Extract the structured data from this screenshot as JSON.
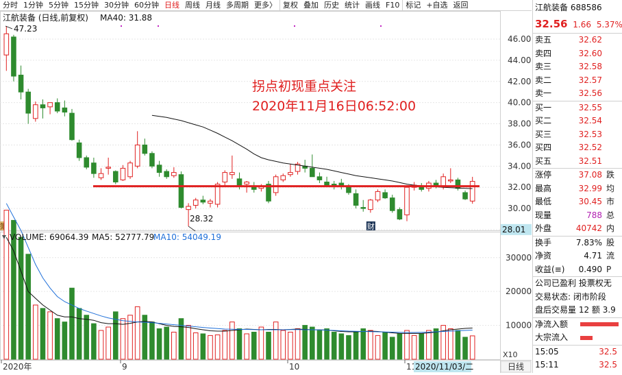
{
  "toolbar": {
    "items": [
      "分时",
      "1分钟",
      "5分钟",
      "15分钟",
      "30分钟",
      "60分钟",
      "日线",
      "周线",
      "月线",
      "多周期",
      "更多〉",
      "复权",
      "叠加",
      "历史",
      "统计",
      "画线",
      "F10",
      "标记",
      "+自选",
      "返回"
    ],
    "active": "日线"
  },
  "kline": {
    "header_name": "江航装备 (日线,前复权)",
    "ma40_label": "MA40: 31.88",
    "y_ticks": [
      "46.00",
      "44.00",
      "42.00",
      "40.00",
      "38.00",
      "36.00",
      "34.00",
      "32.00",
      "30.00",
      "28.00"
    ],
    "high_label": "47.23",
    "low_label": "28.32",
    "price_tag": "28.01",
    "note_text": "拐点初现重点关注",
    "note_time": "2020年11月16日06:52:00",
    "marker_caiwu": "财",
    "marker_left": "簿"
  },
  "volume": {
    "header": "VOLUME: 69064.39",
    "ma5": "MA5: 52777.79",
    "ma10": "MA10: 54049.19",
    "y_ticks": [
      "30000",
      "20000",
      "10000"
    ],
    "unit": "X10"
  },
  "x_axis": {
    "labels": [
      "2020年",
      "9",
      "10",
      "11"
    ],
    "date_box": "2020/11/03/二",
    "period_btn": "日线"
  },
  "colors": {
    "up": "#e02020",
    "down": "#2e8b2e",
    "ma": "#111111",
    "ma10": "#1e6fd9"
  },
  "chart_data": [
    {
      "type": "candlestick",
      "title": "江航装备 (日线,前复权)",
      "ylim": [
        28,
        47.5
      ],
      "ohlc": [
        [
          44.5,
          47.23,
          43.0,
          46.5
        ],
        [
          46.2,
          46.4,
          42.0,
          42.5
        ],
        [
          42.6,
          43.5,
          40.3,
          41.0
        ],
        [
          41.0,
          41.3,
          38.0,
          39.0
        ],
        [
          38.5,
          40.1,
          38.2,
          39.8
        ],
        [
          39.8,
          40.3,
          38.5,
          39.5
        ],
        [
          39.6,
          40.0,
          38.9,
          40.0
        ],
        [
          40.0,
          40.4,
          39.0,
          39.2
        ],
        [
          39.5,
          40.2,
          38.7,
          39.1
        ],
        [
          39.0,
          39.4,
          36.4,
          36.5
        ],
        [
          36.2,
          36.5,
          34.5,
          34.8
        ],
        [
          34.8,
          35.0,
          33.7,
          33.9
        ],
        [
          34.3,
          34.8,
          32.9,
          33.3
        ],
        [
          32.9,
          33.8,
          32.7,
          33.3
        ],
        [
          33.8,
          34.8,
          33.2,
          33.9
        ],
        [
          33.5,
          33.6,
          32.3,
          32.5
        ],
        [
          32.7,
          34.1,
          32.6,
          33.8
        ],
        [
          33.0,
          34.5,
          32.8,
          34.3
        ],
        [
          34.0,
          37.3,
          33.8,
          36.0
        ],
        [
          36.0,
          36.6,
          35.0,
          35.2
        ],
        [
          35.2,
          35.4,
          33.8,
          34.0
        ],
        [
          34.1,
          34.5,
          33.0,
          33.4
        ],
        [
          33.5,
          33.7,
          32.8,
          33.0
        ],
        [
          33.1,
          33.9,
          32.9,
          33.4
        ],
        [
          33.2,
          33.5,
          30.0,
          30.1
        ],
        [
          29.9,
          30.5,
          28.32,
          30.2
        ],
        [
          30.3,
          31.0,
          30.0,
          30.8
        ],
        [
          30.8,
          31.2,
          30.4,
          30.6
        ],
        [
          30.5,
          30.9,
          30.1,
          30.7
        ],
        [
          30.4,
          32.5,
          30.1,
          32.3
        ],
        [
          32.5,
          33.6,
          32.1,
          33.4
        ],
        [
          33.2,
          35.0,
          32.8,
          33.4
        ],
        [
          32.8,
          33.4,
          31.8,
          32.2
        ],
        [
          32.3,
          32.6,
          31.5,
          32.5
        ],
        [
          32.0,
          32.5,
          31.5,
          31.8
        ],
        [
          31.9,
          32.3,
          31.6,
          32.1
        ],
        [
          32.3,
          32.6,
          30.5,
          30.7
        ],
        [
          31.5,
          33.2,
          31.2,
          33.0
        ],
        [
          32.7,
          33.3,
          32.5,
          33.1
        ],
        [
          33.2,
          34.2,
          33.0,
          33.4
        ],
        [
          33.5,
          34.4,
          33.2,
          34.2
        ],
        [
          34.0,
          34.6,
          33.4,
          33.8
        ],
        [
          33.8,
          35.1,
          33.4,
          33.0
        ],
        [
          33.0,
          33.4,
          32.4,
          32.7
        ],
        [
          32.5,
          33.0,
          32.1,
          32.2
        ],
        [
          32.3,
          32.6,
          31.8,
          32.1
        ],
        [
          32.4,
          32.8,
          31.8,
          32.2
        ],
        [
          32.1,
          32.3,
          31.3,
          31.5
        ],
        [
          31.4,
          31.8,
          30.0,
          30.3
        ],
        [
          30.1,
          30.8,
          29.7,
          30.0
        ],
        [
          29.9,
          30.9,
          29.6,
          30.8
        ],
        [
          30.8,
          31.8,
          30.6,
          31.6
        ],
        [
          31.5,
          31.8,
          30.9,
          31.0
        ],
        [
          31.0,
          31.3,
          29.6,
          29.8
        ],
        [
          29.9,
          30.1,
          28.9,
          29.0
        ],
        [
          29.4,
          32.2,
          28.8,
          32.0
        ],
        [
          32.0,
          32.5,
          31.7,
          32.2
        ],
        [
          32.0,
          32.4,
          31.6,
          31.8
        ],
        [
          31.9,
          32.6,
          31.6,
          32.4
        ],
        [
          32.4,
          32.7,
          31.9,
          32.1
        ],
        [
          32.1,
          33.3,
          31.8,
          33.0
        ],
        [
          32.6,
          33.8,
          32.4,
          32.7
        ],
        [
          32.7,
          32.9,
          31.7,
          31.9
        ],
        [
          31.5,
          31.7,
          30.8,
          30.9
        ],
        [
          30.7,
          32.99,
          30.45,
          32.56
        ]
      ],
      "ma40": [
        38.8,
        38.7,
        38.6,
        38.45,
        38.3,
        38.1,
        37.9,
        37.7,
        37.4,
        37.1,
        36.75,
        36.4,
        36.0,
        35.6,
        35.15,
        34.8,
        34.6,
        34.45,
        34.3,
        34.2,
        34.1,
        34.0,
        33.9,
        33.8,
        33.7,
        33.55,
        33.4,
        33.25,
        33.1,
        33.0,
        32.9,
        32.8,
        32.7,
        32.6,
        32.45,
        32.3,
        32.2,
        32.15,
        32.1,
        32.05,
        32.0,
        31.96,
        31.93,
        31.9,
        31.88
      ],
      "ma40_start": 20,
      "support_line": 32.1
    },
    {
      "type": "bar",
      "title": "VOLUME",
      "ylim": [
        0,
        34000
      ],
      "values": [
        44000,
        41000,
        36000,
        31000,
        16000,
        15000,
        14000,
        12000,
        11000,
        21000,
        15000,
        13000,
        10500,
        8500,
        9500,
        14000,
        12000,
        13000,
        15500,
        13000,
        11000,
        9000,
        9500,
        8000,
        12000,
        10000,
        7800,
        7500,
        7000,
        7200,
        8500,
        11000,
        9000,
        7500,
        8000,
        9500,
        8000,
        11000,
        8500,
        8000,
        9000,
        10000,
        9500,
        8500,
        9000,
        8000,
        7500,
        7000,
        8000,
        9000,
        8500,
        7000,
        8000,
        6500,
        7500,
        8500,
        7000,
        7500,
        8500,
        9000,
        10000,
        9000,
        8500,
        6500,
        6900
      ],
      "ma5": [
        36000,
        32000,
        26000,
        20000,
        18000,
        16000,
        14500,
        13000,
        12500,
        12500,
        12000,
        11800,
        11500,
        10800,
        10500,
        10500,
        10300,
        10600,
        11000,
        11200,
        11000,
        10500,
        10000,
        9700,
        9600,
        9400,
        9000,
        8700,
        8400,
        8300,
        8300,
        8500,
        8700,
        8900,
        8800,
        8700,
        8800,
        8800,
        8700,
        8800,
        8900,
        8800,
        8700,
        8700,
        8600,
        8400,
        8200,
        8100,
        8100,
        8200,
        8300,
        8200,
        8000,
        7800,
        7600,
        7600,
        7600,
        7600,
        7800,
        8000,
        8400,
        8700,
        8900,
        9100,
        9200
      ],
      "ma10": [
        46000,
        42000,
        38000,
        33000,
        28000,
        24000,
        21000,
        18500,
        17000,
        16000,
        15000,
        14200,
        13500,
        12800,
        12200,
        11800,
        11400,
        11200,
        11000,
        10900,
        10800,
        10600,
        10400,
        10200,
        10000,
        9800,
        9600,
        9400,
        9200,
        9050,
        8900,
        8850,
        8800,
        8800,
        8750,
        8700,
        8700,
        8700,
        8700,
        8750,
        8750,
        8700,
        8700,
        8650,
        8600,
        8500,
        8400,
        8300,
        8250,
        8200,
        8150,
        8100,
        8050,
        8000,
        7950,
        7900,
        7900,
        7950,
        8000,
        8100,
        8200,
        8300,
        8400,
        8500,
        8600
      ]
    }
  ],
  "panel": {
    "title": "江航装备 688586",
    "price": "32.56",
    "change": "1.66",
    "pct": "5.37%",
    "asks": [
      {
        "label": "卖五",
        "price": "32.62"
      },
      {
        "label": "卖四",
        "price": "32.60"
      },
      {
        "label": "卖三",
        "price": "32.58"
      },
      {
        "label": "卖二",
        "price": "32.57"
      },
      {
        "label": "卖一",
        "price": "32.56"
      }
    ],
    "bids": [
      {
        "label": "买一",
        "price": "32.55"
      },
      {
        "label": "买二",
        "price": "32.54"
      },
      {
        "label": "买三",
        "price": "32.53"
      },
      {
        "label": "买四",
        "price": "32.52"
      },
      {
        "label": "买五",
        "price": "32.51"
      }
    ],
    "stats": [
      {
        "label": "涨停",
        "value": "37.08",
        "extra": "跌"
      },
      {
        "label": "最高",
        "value": "32.99",
        "extra": "均"
      },
      {
        "label": "最低",
        "value": "30.45",
        "extra": "市"
      },
      {
        "label": "现量",
        "value": "788",
        "extra": "总"
      },
      {
        "label": "外盘",
        "value": "40742",
        "extra": "内"
      }
    ],
    "stats2": [
      {
        "label": "换手",
        "value": "7.83%",
        "extra": "股"
      },
      {
        "label": "净资",
        "value": "4.71",
        "extra": "流"
      },
      {
        "label": "收益(≡)",
        "value": "0.490",
        "extra": "P"
      }
    ],
    "info1": "公司已盈利 投票权无",
    "info2": "交易状态: 闭市阶段",
    "info3": "盘后交易量 12 额 3.9",
    "flow1": "净流入额",
    "flow2": "大宗流入",
    "ticks": [
      {
        "time": "15:05",
        "price": "32.5"
      },
      {
        "time": "15:11",
        "price": "32.5"
      },
      {
        "time": "15:24",
        "price": "32.5"
      }
    ]
  }
}
